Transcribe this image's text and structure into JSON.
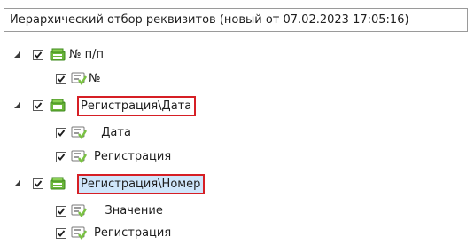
{
  "header": {
    "title": "Иерархический отбор реквизитов (новый от 07.02.2023 17:05:16)"
  },
  "tree": {
    "group1": {
      "label": "№ п/п",
      "children": [
        {
          "label": "№"
        }
      ]
    },
    "group2": {
      "label": "Регистрация\\Дата",
      "children": [
        {
          "label": "  Дата"
        },
        {
          "label": "Регистрация"
        }
      ]
    },
    "group3": {
      "label": "Регистрация\\Номер",
      "children": [
        {
          "label": "   Значение"
        },
        {
          "label": "Регистрация"
        }
      ]
    }
  },
  "colors": {
    "highlight_border": "#d61f25",
    "selection_background": "#cfe6fb",
    "folder_icon": "#6bb63a",
    "field_icon": "#7ac143"
  },
  "icons": {
    "expander": "triangle-expanded-icon",
    "checkbox": "checkmark-icon",
    "group": "folder-group-icon",
    "field": "field-attribute-icon"
  }
}
